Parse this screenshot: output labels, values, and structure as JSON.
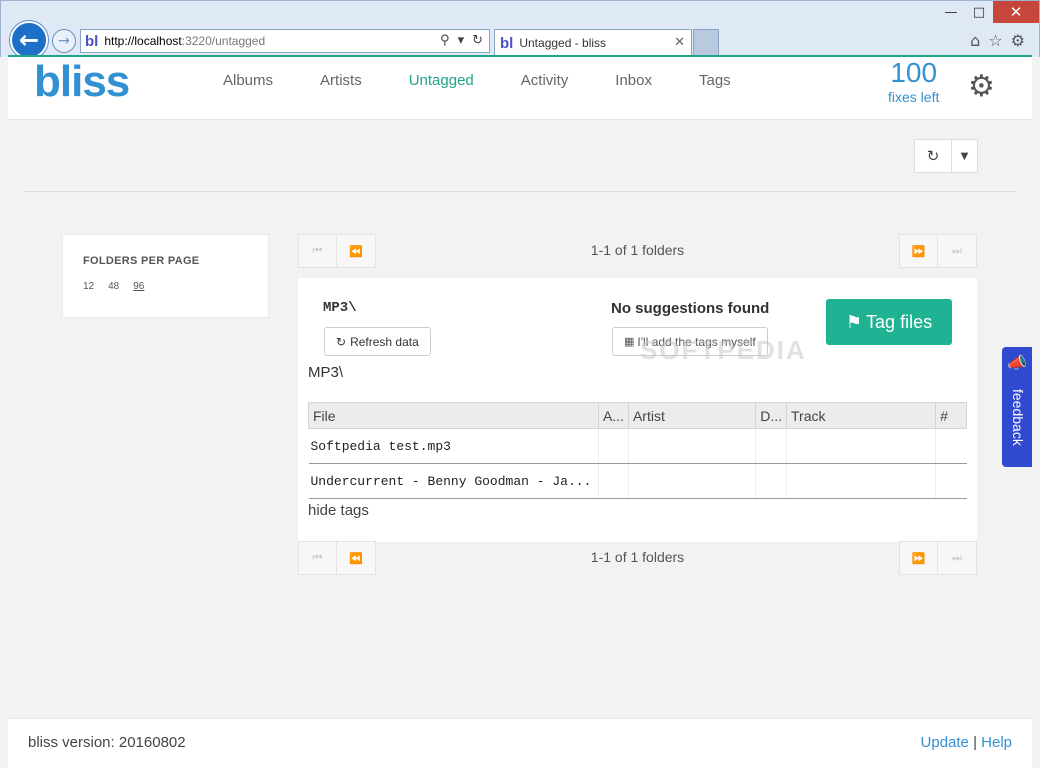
{
  "browser": {
    "url_host": "http://localhost",
    "url_rest": ":3220/untagged",
    "favicon": "bl",
    "tab_title": "Untagged - bliss",
    "icons": [
      "back-arrow-icon",
      "forward-arrow-icon",
      "search-icon",
      "refresh-icon",
      "home-icon",
      "star-icon",
      "gear-icon"
    ]
  },
  "app": {
    "logo": "bliss",
    "nav": [
      "Albums",
      "Artists",
      "Untagged",
      "Activity",
      "Inbox",
      "Tags"
    ],
    "active_nav": "Untagged",
    "fixes_count": "100",
    "fixes_label": "fixes left"
  },
  "sidebar": {
    "title": "FOLDERS PER PAGE",
    "options": [
      "12",
      "48",
      "96"
    ],
    "selected": "96"
  },
  "pager": {
    "text": "1-1 of 1 folders"
  },
  "folder": {
    "name": "MP3\\",
    "refresh_label": "Refresh data",
    "no_suggestions": "No suggestions found",
    "add_tags_label": "I'll add the tags myself",
    "tag_files_label": "Tag files",
    "folder_label": "MP3\\",
    "columns": [
      "File",
      "A...",
      "Artist",
      "D...",
      "Track",
      "#"
    ],
    "rows": [
      {
        "file": "Softpedia test.mp3"
      },
      {
        "file": "Undercurrent - Benny Goodman - Ja..."
      }
    ],
    "hide_tags": "hide tags"
  },
  "watermark": "SOFTPEDIA",
  "feedback": "feedback",
  "footer": {
    "version": "bliss version: 20160802",
    "update": "Update",
    "sep": " | ",
    "help": "Help"
  },
  "colors": {
    "brand_blue": "#3291d1",
    "accent_green": "#1fa589",
    "tag_button": "#1fb393",
    "feedback_bg": "#2f49d1"
  }
}
